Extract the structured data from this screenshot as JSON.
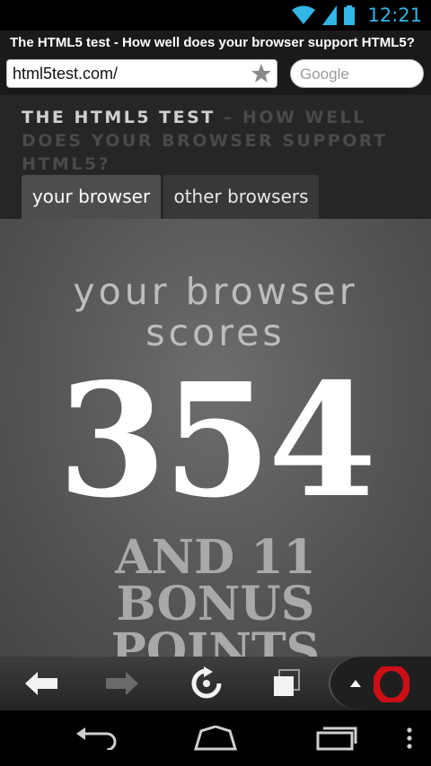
{
  "status_bar": {
    "time": "12:21",
    "icons": [
      "wifi-icon",
      "signal-icon",
      "battery-icon"
    ]
  },
  "page_title": "The HTML5 test - How well does your browser support HTML5?",
  "address_bar": {
    "url": "html5test.com/",
    "search_placeholder": "Google"
  },
  "header": {
    "title_strong": "THE HTML5 TEST",
    "title_rest": " – HOW WELL DOES YOUR BROWSER SUPPORT HTML5?"
  },
  "tabs": [
    {
      "label": "your browser",
      "active": true
    },
    {
      "label": "other browsers",
      "active": false
    }
  ],
  "result": {
    "line1": "your browser",
    "line2": "scores",
    "score": "354",
    "bonus_line1": "AND 11",
    "bonus_line2": "BONUS",
    "bonus_line3": "POINTS"
  },
  "toolbar": {
    "icons": [
      "back-arrow-icon",
      "forward-arrow-icon",
      "reload-icon",
      "tabs-icon",
      "opera-menu-icon"
    ]
  },
  "navbar": {
    "icons": [
      "back-icon",
      "home-icon",
      "recent-apps-icon",
      "menu-icon"
    ]
  },
  "colors": {
    "accent": "#33b5e5",
    "opera_red": "#cc0f16"
  }
}
